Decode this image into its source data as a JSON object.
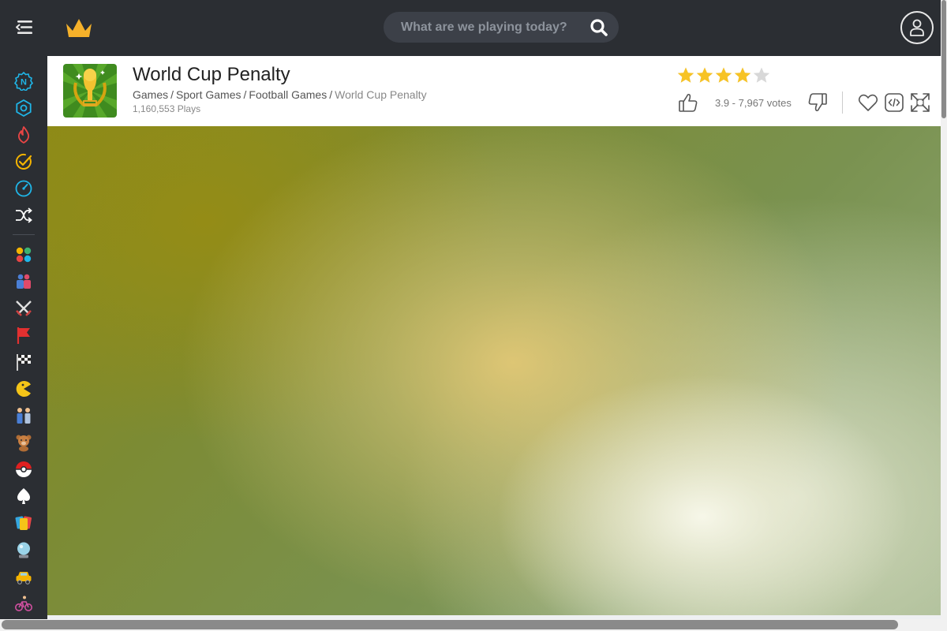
{
  "topbar": {
    "menu_icon": "menu-collapse-icon",
    "logo_icon": "crown-icon",
    "search": {
      "placeholder": "What are we playing today?",
      "value": ""
    },
    "search_icon": "search-icon",
    "user_icon": "user-icon"
  },
  "sidebar": {
    "items": [
      {
        "icon": "new-games-icon",
        "color": "#1fb6e8"
      },
      {
        "icon": "updated-games-icon",
        "color": "#1fb6e8"
      },
      {
        "icon": "hot-games-icon",
        "color": "#e84545"
      },
      {
        "icon": "completed-check-icon",
        "color": "#f5b400"
      },
      {
        "icon": "speedometer-icon",
        "color": "#1fb6e8"
      },
      {
        "icon": "shuffle-icon",
        "color": "#ffffff"
      },
      {
        "icon": "all-categories-icon",
        "color": "#f5b400"
      },
      {
        "icon": "two-player-icon",
        "color": "#4a7fd6"
      },
      {
        "icon": "swords-icon",
        "color": "#e0e0e0"
      },
      {
        "icon": "flag-icon",
        "color": "#e23030"
      },
      {
        "icon": "racing-flag-icon",
        "color": "#ffffff"
      },
      {
        "icon": "pacman-icon",
        "color": "#f5c518"
      },
      {
        "icon": "couple-icon",
        "color": "#b0c4de"
      },
      {
        "icon": "teddy-bear-icon",
        "color": "#b06d35"
      },
      {
        "icon": "pokeball-icon",
        "color": "#e02020"
      },
      {
        "icon": "spade-icon",
        "color": "#ffffff"
      },
      {
        "icon": "cards-icon",
        "color": "#35a7e0"
      },
      {
        "icon": "crystal-ball-icon",
        "color": "#9ad3e8"
      },
      {
        "icon": "taxi-icon",
        "color": "#f5b400"
      },
      {
        "icon": "bicycle-icon",
        "color": "#d050a0"
      }
    ]
  },
  "game": {
    "title": "World Cup Penalty",
    "breadcrumb": {
      "items": [
        "Games",
        "Sport Games",
        "Football Games"
      ],
      "separator": "/",
      "current": "World Cup Penalty"
    },
    "plays": "1,160,553 Plays",
    "rating": 3.9,
    "rating_max": 5,
    "votes_text": "3.9 - 7,967 votes",
    "thumbnail_icon": "world-cup-trophy-icon",
    "like_icon": "thumbs-up-icon",
    "dislike_icon": "thumbs-down-icon",
    "favorite_icon": "heart-icon",
    "embed_icon": "embed-code-icon",
    "fullscreen_icon": "fullscreen-icon"
  },
  "colors": {
    "topbar_bg": "#2b2e33",
    "star_filled": "#f7c325",
    "star_empty": "#d8d8d8"
  }
}
